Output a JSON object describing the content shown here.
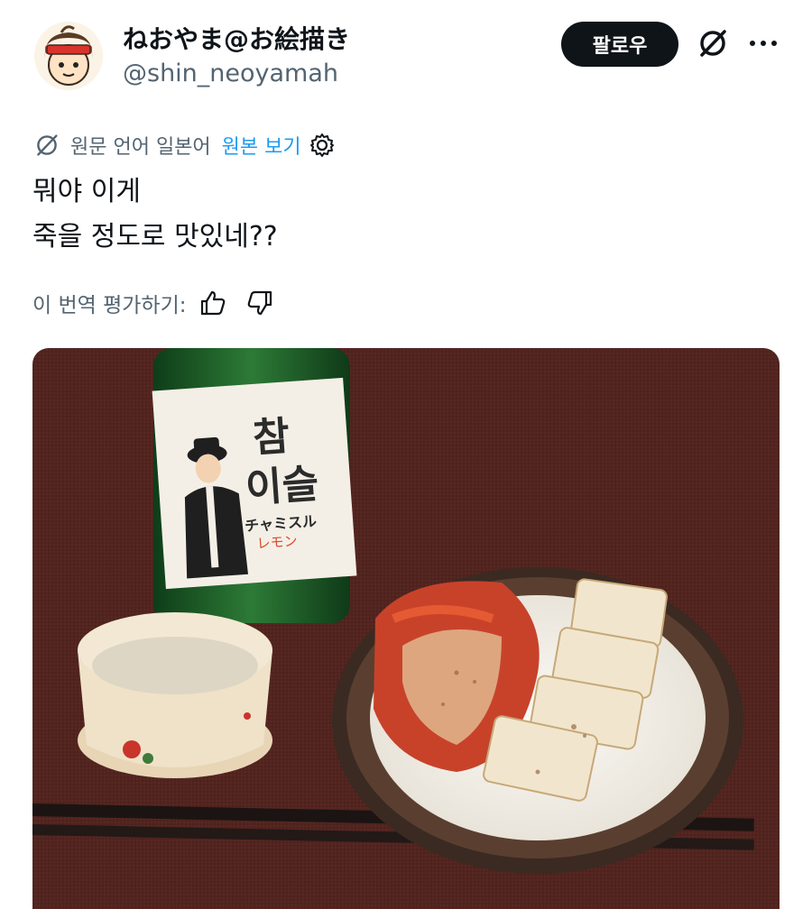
{
  "user": {
    "display_name": "ねおやま@お絵描き",
    "handle": "@shin_neoyamah",
    "avatar_icon": "avatar-icon"
  },
  "actions": {
    "follow_label": "팔로우",
    "grok_icon": "grok-icon",
    "more_icon": "more-icon"
  },
  "translation": {
    "note": "원문 언어 일본어",
    "show_original": "원본 보기",
    "settings_icon": "gear-icon"
  },
  "tweet": {
    "line1": "뭐야 이게",
    "line2": "죽을 정도로 맛있네??"
  },
  "rating": {
    "label": "이 번역 평가하기:",
    "up_icon": "thumbs-up-icon",
    "down_icon": "thumbs-down-icon"
  },
  "photo": {
    "bottle_label_main1": "참",
    "bottle_label_main2": "이슬",
    "bottle_label_kana1": "チャミスル",
    "bottle_label_kana2": "レモン"
  },
  "colors": {
    "link": "#1d9bf0",
    "muted": "#536471",
    "follow_bg": "#0f1419"
  }
}
